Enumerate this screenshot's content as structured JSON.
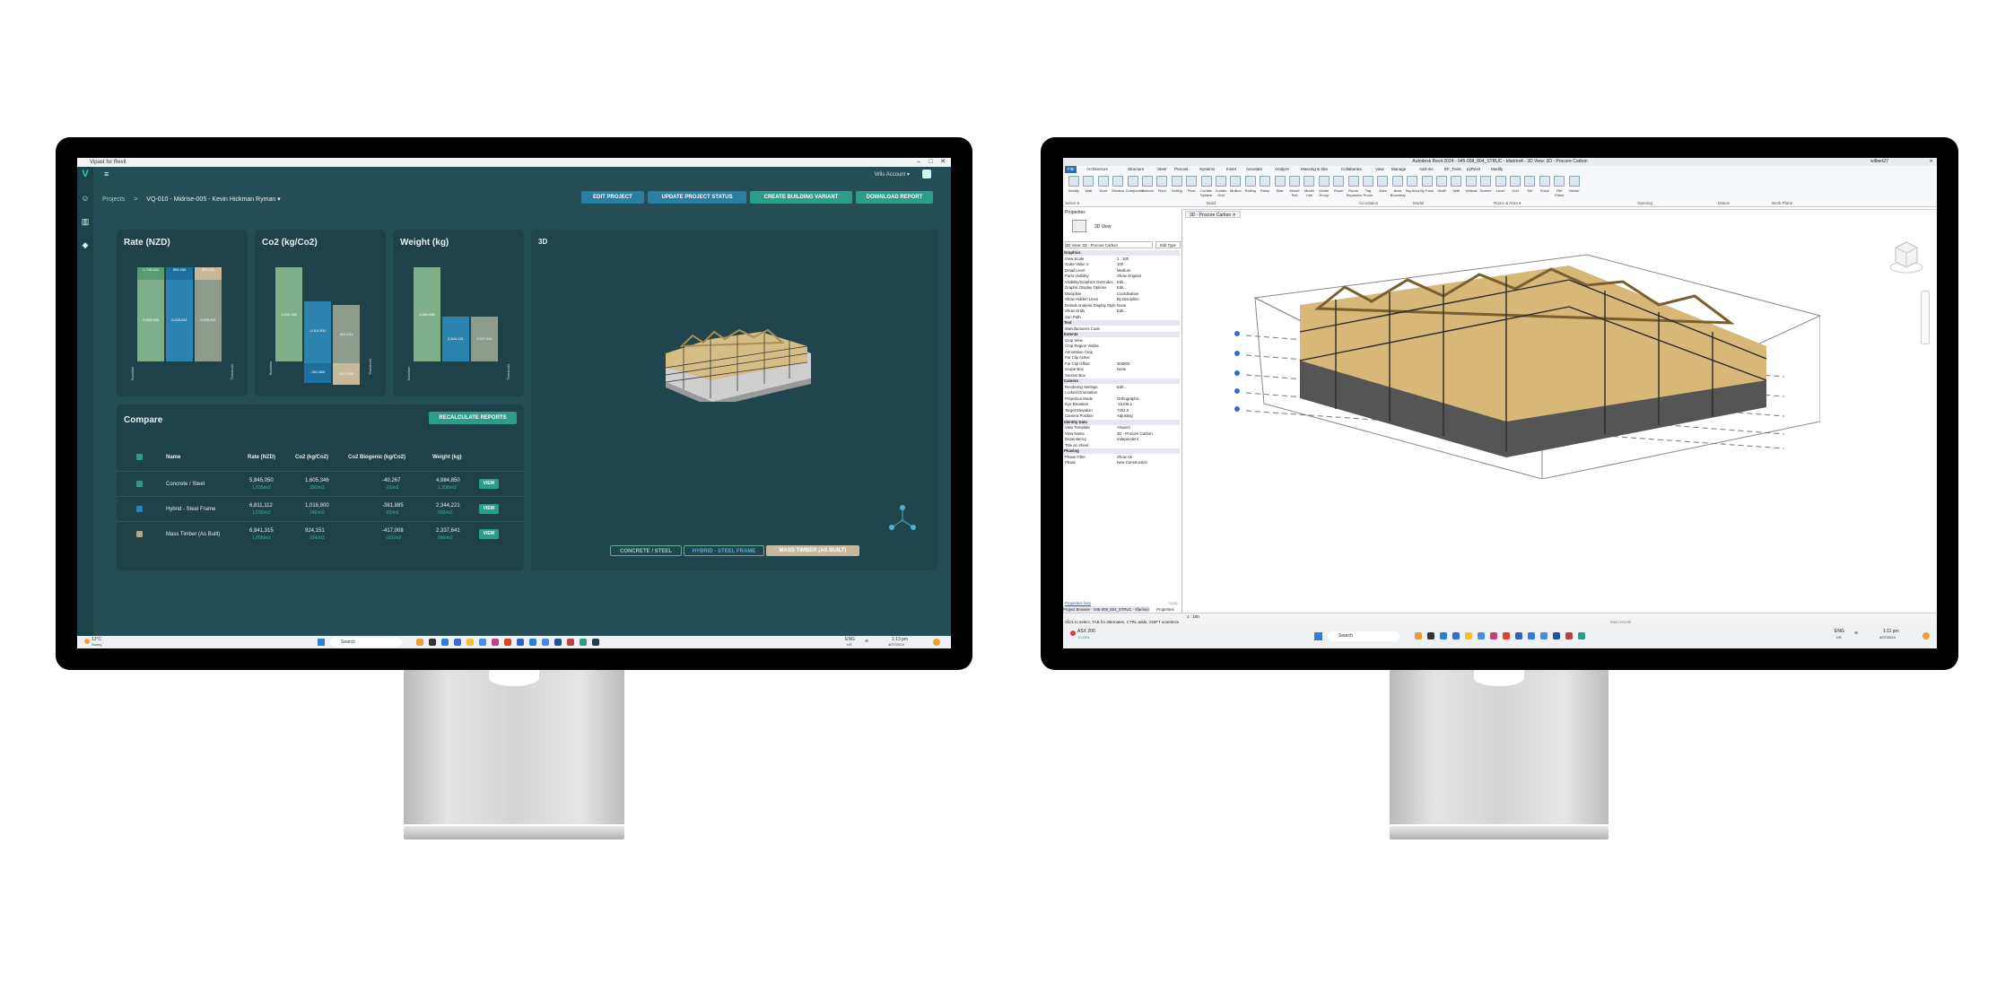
{
  "left": {
    "window_title": "Vipast for Revit",
    "user": "Wils Account ▾",
    "breadcrumb": {
      "root": "Projects",
      "sep": ">",
      "project": "VQ-010 - Midrise-005 - Kevin Hickman Ryman ▾"
    },
    "actions": [
      "EDIT PROJECT",
      "UPDATE PROJECT STATUS",
      "CREATE BUILDING VARIANT",
      "DOWNLOAD REPORT"
    ],
    "cards": {
      "rate": {
        "title": "Rate (NZD)",
        "top_labels": [
          "1,726,582",
          "896,466",
          "899,033"
        ],
        "mid_labels": [
          "5,888,068",
          "5,928,651",
          "5,658,651"
        ],
        "axis": [
          "Baseline",
          "Threshold"
        ]
      },
      "co2": {
        "title": "Co2 (kg/Co2)",
        "top_labels": [
          "1,605,346",
          "1,016,900",
          "924,151"
        ],
        "neg_labels": [
          "-381,885",
          "-417,008"
        ],
        "axis": [
          "Baseline",
          "Threshold"
        ]
      },
      "weight": {
        "title": "Weight (kg)",
        "labels": [
          "4,984,850",
          "2,344,221",
          "2,337,641"
        ],
        "axis": [
          "Baseline",
          "Threshold"
        ]
      },
      "view3d": {
        "title": "3D"
      }
    },
    "compare": {
      "title": "Compare",
      "recalc": "RECALCULATE REPORTS",
      "headers": [
        "Name",
        "Rate (NZD)",
        "Co2 (kg/Co2)",
        "Co2 Biogenic (kg/Co2)",
        "Weight (kg)"
      ],
      "rows": [
        {
          "name": "Concrete / Steel",
          "rate": "5,845,050",
          "rate_sub": "1,635/m2",
          "co2": "1,605,346",
          "co2_sub": "390/m2",
          "bio": "-40,267",
          "bio_sub": "-10/m2",
          "weight": "4,984,850",
          "weight_sub": "1,208/m2",
          "btn": "VIEW"
        },
        {
          "name": "Hybrid - Steel Frame",
          "rate": "6,811,112",
          "rate_sub": "1,630/m2",
          "co2": "1,016,900",
          "co2_sub": "246/m2",
          "bio": "-381,885",
          "bio_sub": "-92/m2",
          "weight": "2,344,221",
          "weight_sub": "568/m2",
          "btn": "VIEW"
        },
        {
          "name": "Mass Timber (As Built)",
          "rate": "6,841,315",
          "rate_sub": "1,658/m2",
          "co2": "924,151",
          "co2_sub": "224/m2",
          "bio": "-417,008",
          "bio_sub": "-101/m2",
          "weight": "2,337,641",
          "weight_sub": "566/m2",
          "btn": "VIEW"
        }
      ]
    },
    "variant_tabs": [
      "CONCRETE / STEEL",
      "HYBRID - STEEL FRAME",
      "MASS TIMBER (AS BUILT)"
    ],
    "taskbar": {
      "weather": "12°C",
      "weather_sub": "Sunny",
      "search": "Search",
      "lang": "ENG",
      "lang_sub": "US",
      "time": "1:13 pm",
      "date": "4/07/2024"
    }
  },
  "right": {
    "window_title": "Autodesk Revit 2024 - 045-008_804_STRUC - kfaririni4 - 3D View: 3D - Procore Carbon",
    "user": "wilbert27",
    "tabs": [
      "File",
      "Architecture",
      "Structure",
      "Steel",
      "Precast",
      "Systems",
      "Insert",
      "Annotate",
      "Analyze",
      "Massing & Site",
      "Collaborate",
      "View",
      "Manage",
      "Add-Ins",
      "EF_Tools",
      "pyRevit",
      "Modify"
    ],
    "ribbon_tools": [
      "Modify",
      "Wall",
      "Door",
      "Window",
      "Component",
      "Column",
      "Roof",
      "Ceiling",
      "Floor",
      "Curtain System",
      "Curtain Grid",
      "Mullion",
      "Railing",
      "Ramp",
      "Stair",
      "Model Text",
      "Model Line",
      "Model Group",
      "Room",
      "Room Separator",
      "Tag Room",
      "Area",
      "Area Boundary",
      "Tag Area",
      "By Face",
      "Shaft",
      "Wall",
      "Vertical",
      "Dormer",
      "Level",
      "Grid",
      "Set",
      "Show",
      "Ref Plane",
      "Viewer"
    ],
    "ribbon_groups": [
      "Select ▾",
      "Build",
      "Circulation",
      "Model",
      "Room & Area ▾",
      "Opening",
      "Datum",
      "Work Plane"
    ],
    "view_tab": "3D - Procore Carbon",
    "properties": {
      "title": "Properties",
      "type": "3D View",
      "selector": "3D View: 3D - Procore Carbon",
      "edit_type": "Edit Type",
      "rows": [
        {
          "k": "Graphics",
          "h": true
        },
        {
          "k": "View Scale",
          "v": "1 : 100"
        },
        {
          "k": "Scale Value 1:",
          "v": "100"
        },
        {
          "k": "Detail Level",
          "v": "Medium"
        },
        {
          "k": "Parts Visibility",
          "v": "Show Original"
        },
        {
          "k": "Visibility/Graphics Overrides",
          "v": "Edit..."
        },
        {
          "k": "Graphic Display Options",
          "v": "Edit..."
        },
        {
          "k": "Discipline",
          "v": "Coordination"
        },
        {
          "k": "Show Hidden Lines",
          "v": "By Discipline"
        },
        {
          "k": "Default Analysis Display Style",
          "v": "None"
        },
        {
          "k": "Show Grids",
          "v": "Edit..."
        },
        {
          "k": "Sun Path",
          "v": ""
        },
        {
          "k": "Text",
          "h": true
        },
        {
          "k": "Manufacturers Code",
          "v": ""
        },
        {
          "k": "Extents",
          "h": true
        },
        {
          "k": "Crop View",
          "v": ""
        },
        {
          "k": "Crop Region Visible",
          "v": ""
        },
        {
          "k": "Annotation Crop",
          "v": ""
        },
        {
          "k": "Far Clip Active",
          "v": ""
        },
        {
          "k": "Far Clip Offset",
          "v": "304800"
        },
        {
          "k": "Scope Box",
          "v": "None"
        },
        {
          "k": "Section Box",
          "v": ""
        },
        {
          "k": "Camera",
          "h": true
        },
        {
          "k": "Rendering Settings",
          "v": "Edit..."
        },
        {
          "k": "Locked Orientation",
          "v": ""
        },
        {
          "k": "Projection Mode",
          "v": "Orthographic"
        },
        {
          "k": "Eye Elevation",
          "v": "-15245.1"
        },
        {
          "k": "Target Elevation",
          "v": "7252.0"
        },
        {
          "k": "Camera Position",
          "v": "Adjusting"
        },
        {
          "k": "Identity Data",
          "h": true
        },
        {
          "k": "View Template",
          "v": "<None>"
        },
        {
          "k": "View Name",
          "v": "3D - Procore Carbon"
        },
        {
          "k": "Dependency",
          "v": "Independent"
        },
        {
          "k": "Title on Sheet",
          "v": ""
        },
        {
          "k": "Phasing",
          "h": true
        },
        {
          "k": "Phase Filter",
          "v": "Show All"
        },
        {
          "k": "Phase",
          "v": "New Construction"
        }
      ],
      "help": "Properties help",
      "apply": "Apply"
    },
    "browser_tabs": [
      "Project Browser - 045-008_804_STRUC - kfaririni4",
      "Properties"
    ],
    "view_scale": "1 : 100",
    "status": "Click to select, TAB for alternates, CTRL adds, SHIFT unselects.",
    "main_model": "Main Model",
    "taskbar": {
      "stock": "ASX 200",
      "stock_sub": "+0.09%",
      "search": "Search",
      "lang": "ENG",
      "lang_sub": "US",
      "time": "1:11 pm",
      "date": "4/07/2024"
    }
  }
}
